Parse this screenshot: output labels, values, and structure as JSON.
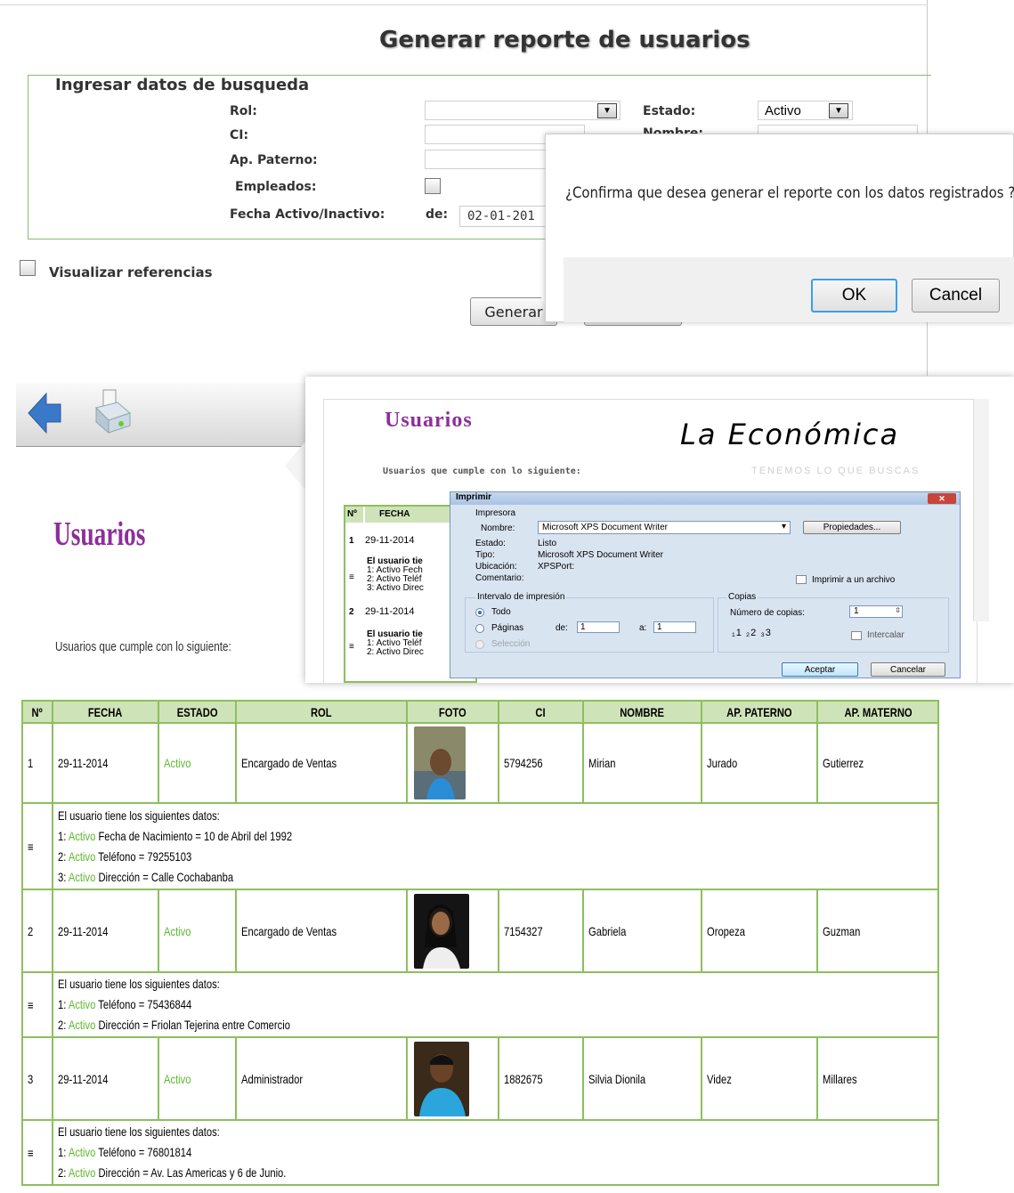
{
  "form": {
    "title": "Generar reporte de usuarios",
    "legend": "Ingresar datos de busqueda",
    "rol_label": "Rol:",
    "ci_label": "CI:",
    "paterno_label": "Ap. Paterno:",
    "empleados_label": "Empleados:",
    "fecha_label": "Fecha Activo/Inactivo:",
    "de_label": "de:",
    "fecha_value": "02-01-201",
    "estado_label": "Estado:",
    "estado_value": "Activo",
    "nombre_label_partial": "Nombre:",
    "ver_referencias": "Visualizar referencias",
    "generar_button": "Generar"
  },
  "confirm_dialog": {
    "message": "¿Confirma que desea generar el reporte con los datos registrados ?",
    "ok": "OK",
    "cancel": "Cancel"
  },
  "report": {
    "title": "Usuarios",
    "subtitle": "Usuarios que cumple con lo siguiente:"
  },
  "preview": {
    "title": "Usuarios",
    "brand": "La Económica",
    "tagline": "TENEMOS LO QUE BUSCAS",
    "subtitle": "Usuarios que cumple con lo siguiente:",
    "col_n": "Nº",
    "col_fecha": "FECHA",
    "row1_n": "1",
    "row1_fecha": "29-11-2014",
    "row1_detail": "El usuario tie",
    "row1_d1": "1: Activo Fech",
    "row1_d2": "2: Activo Teléf",
    "row1_d3": "3: Activo Direc",
    "row2_n": "2",
    "row2_fecha": "29-11-2014",
    "row2_detail": "El usuario tie",
    "row2_d1": "1: Activo Teléf",
    "row2_d2": "2: Activo Direc"
  },
  "print_dialog": {
    "title": "Imprimir",
    "printer_group": "Impresora",
    "name_label": "Nombre:",
    "name_value": "Microsoft XPS Document Writer",
    "props_button": "Propiedades...",
    "state_label": "Estado:",
    "state_value": "Listo",
    "type_label": "Tipo:",
    "type_value": "Microsoft XPS Document Writer",
    "location_label": "Ubicación:",
    "location_value": "XPSPort:",
    "comment_label": "Comentario:",
    "to_file": "Imprimir a un archivo",
    "range_group": "Intervalo de impresión",
    "all": "Todo",
    "pages": "Páginas",
    "from_label": "de:",
    "from_value": "1",
    "to_label": "a:",
    "to_value": "1",
    "selection": "Selección",
    "copies_group": "Copias",
    "copies_label": "Número de copias:",
    "copies_value": "1",
    "collate": "Intercalar",
    "accept": "Aceptar",
    "cancel": "Cancelar"
  },
  "table": {
    "headers": [
      "Nº",
      "FECHA",
      "ESTADO",
      "ROL",
      "FOTO",
      "CI",
      "NOMBRE",
      "AP. PATERNO",
      "AP. MATERNO"
    ],
    "rows": [
      {
        "n": "1",
        "fecha": "29-11-2014",
        "estado": "Activo",
        "rol": "Encargado de Ventas",
        "ci": "5794256",
        "nombre": "Mirian",
        "paterno": "Jurado",
        "materno": "Gutierrez",
        "details_title": "El usuario tiene los siguientes datos:",
        "details": [
          {
            "n": "1:",
            "estado": "Activo",
            "text": "Fecha de Nacimiento = 10 de Abril del 1992"
          },
          {
            "n": "2:",
            "estado": "Activo",
            "text": "Teléfono = 79255103"
          },
          {
            "n": "3:",
            "estado": "Activo",
            "text": "Dirección = Calle Cochabanba"
          }
        ]
      },
      {
        "n": "2",
        "fecha": "29-11-2014",
        "estado": "Activo",
        "rol": "Encargado de Ventas",
        "ci": "7154327",
        "nombre": "Gabriela",
        "paterno": "Oropeza",
        "materno": "Guzman",
        "details_title": "El usuario tiene los siguientes datos:",
        "details": [
          {
            "n": "1:",
            "estado": "Activo",
            "text": "Teléfono = 75436844"
          },
          {
            "n": "2:",
            "estado": "Activo",
            "text": "Dirección = Friolan Tejerina entre Comercio"
          }
        ]
      },
      {
        "n": "3",
        "fecha": "29-11-2014",
        "estado": "Activo",
        "rol": "Administrador",
        "ci": "1882675",
        "nombre": "Silvia Dionila",
        "paterno": "Videz",
        "materno": "Millares",
        "details_title": "El usuario tiene los siguientes datos:",
        "details": [
          {
            "n": "1:",
            "estado": "Activo",
            "text": "Teléfono = 76801814"
          },
          {
            "n": "2:",
            "estado": "Activo",
            "text": "Dirección = Av. Las Americas y 6 de Junio."
          }
        ]
      }
    ]
  },
  "colors": {
    "accent_green": "#8cbf5e",
    "status_green": "#5fb82e",
    "title_purple": "#8c2f9a",
    "dialog_focus": "#3c9ee8"
  }
}
